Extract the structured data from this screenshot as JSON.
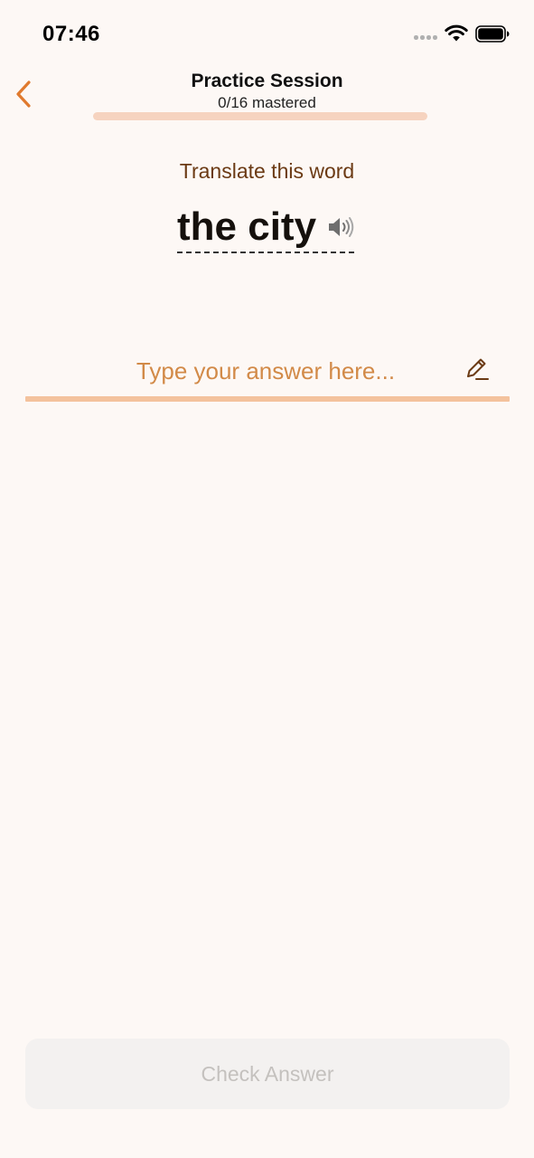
{
  "status_bar": {
    "time": "07:46",
    "icons": [
      "signal-dots-icon",
      "wifi-icon",
      "battery-icon"
    ]
  },
  "header": {
    "back_icon": "chevron-left-icon",
    "title": "Practice Session",
    "subtitle": "0/16 mastered",
    "progress": 0
  },
  "prompt": {
    "label": "Translate this word",
    "word": "the city",
    "audio_icon": "speaker-icon"
  },
  "answer": {
    "placeholder": "Type your answer here...",
    "value": "",
    "edit_icon": "pencil-icon"
  },
  "check_button": {
    "label": "Check Answer",
    "disabled": true
  },
  "colors": {
    "background": "#FDF8F5",
    "accent": "#E07A2E",
    "progress_track": "#F6D3BF",
    "input_underline": "#F4C29D",
    "prompt_text": "#6B3A14"
  }
}
